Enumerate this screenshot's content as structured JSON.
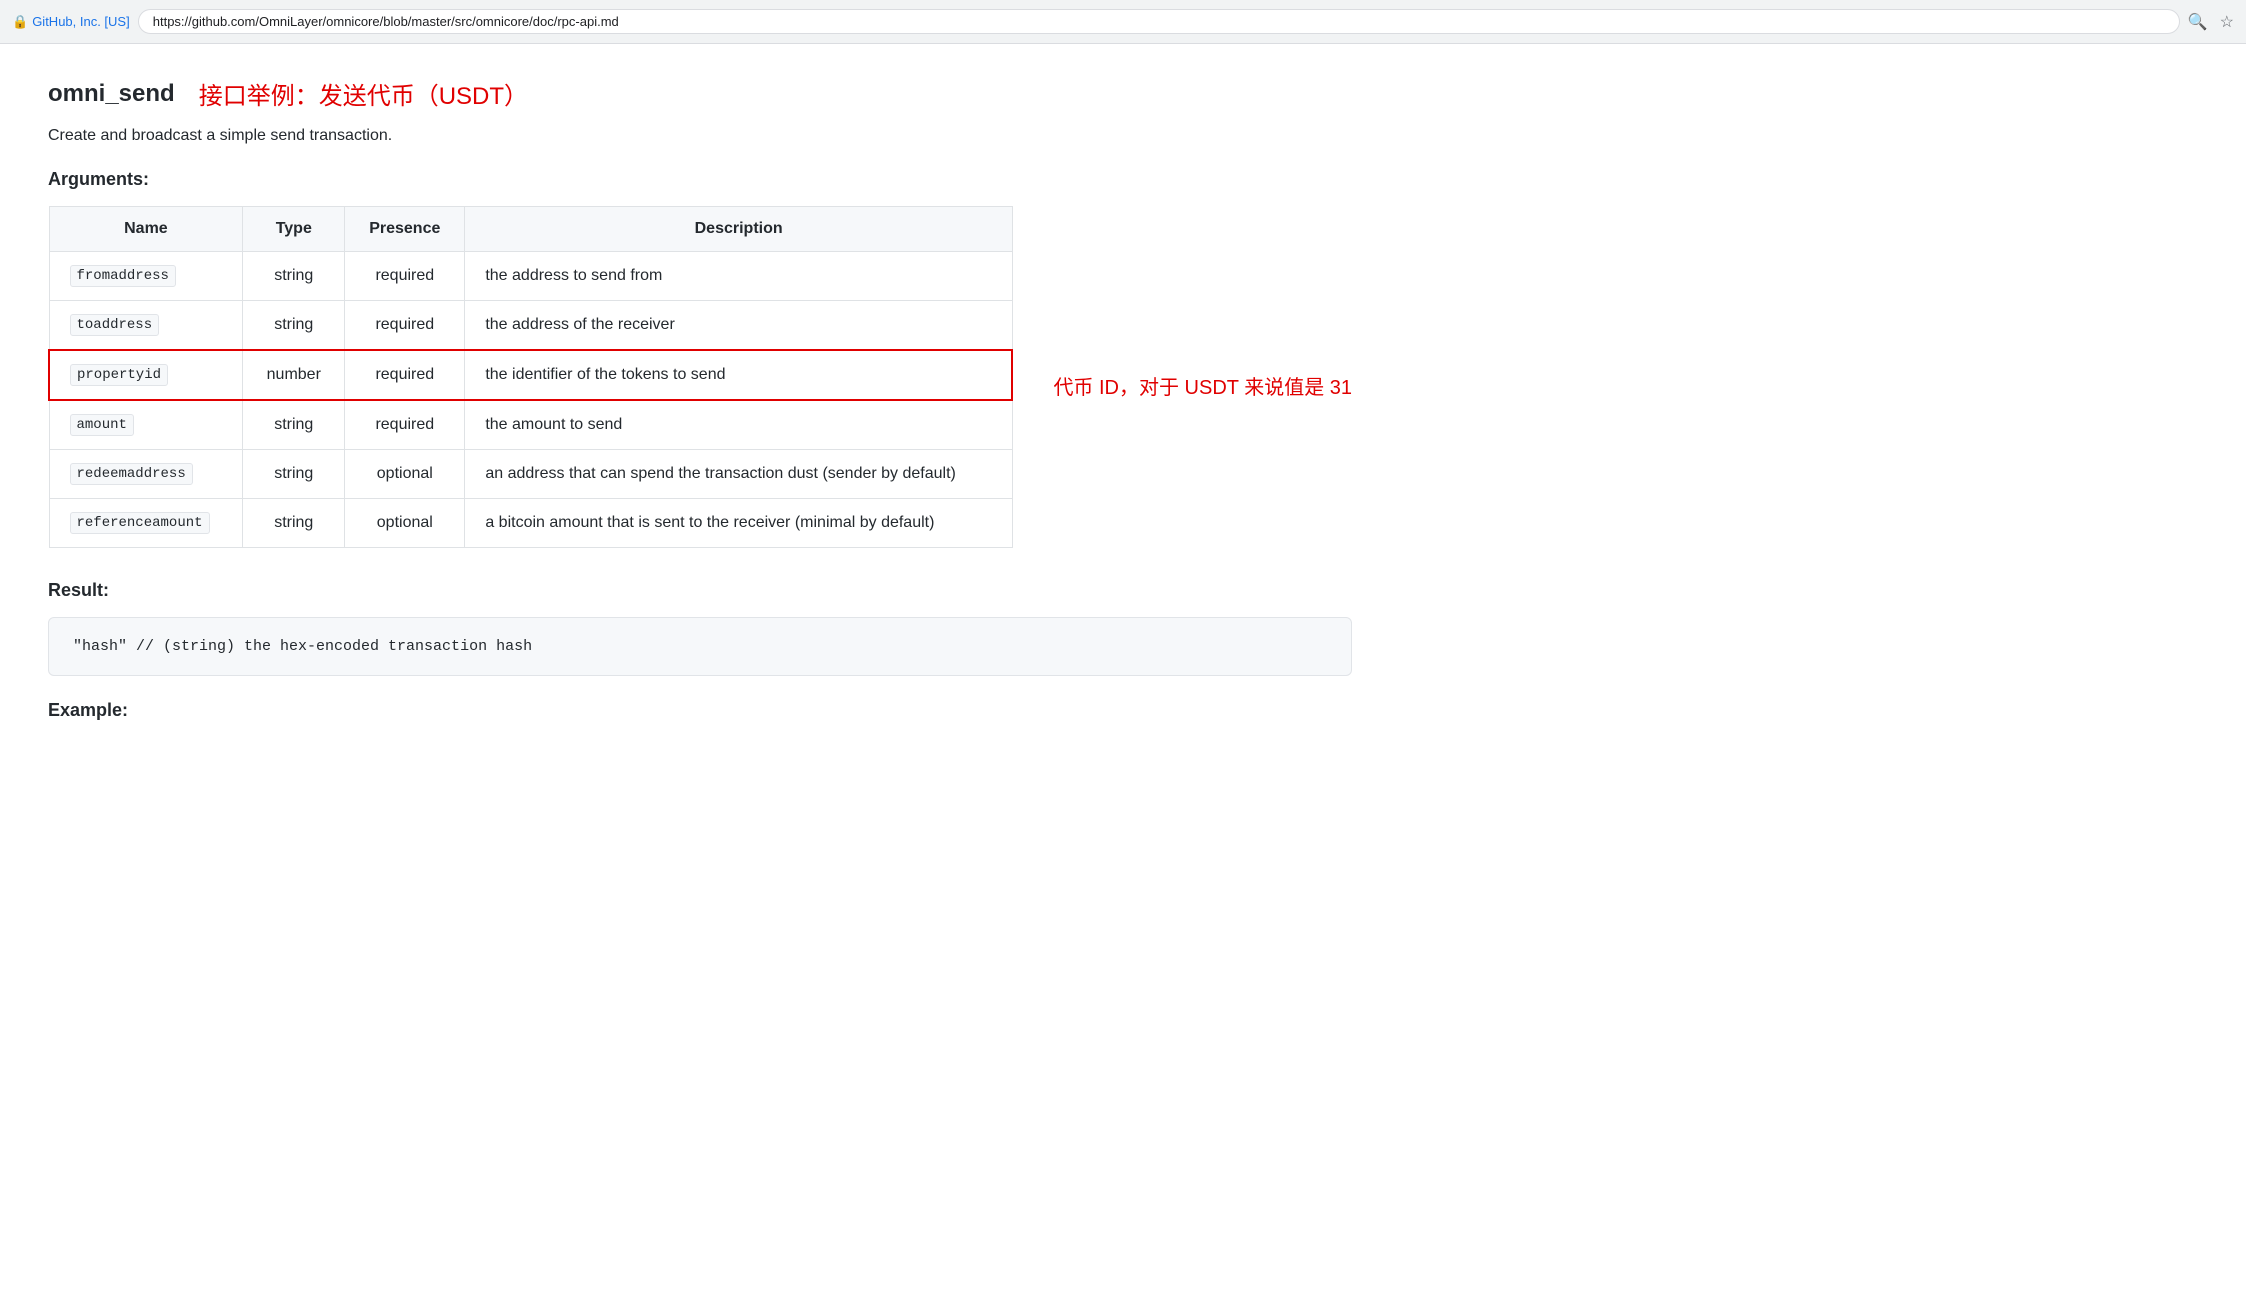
{
  "browser": {
    "security_label": "GitHub, Inc. [US]",
    "url": "https://github.com/OmniLayer/omnicore/blob/master/src/omnicore/doc/rpc-api.md",
    "url_prefix": "https://",
    "url_domain": "github.com",
    "url_path": "/OmniLayer/omnicore/blob/master/src/omnicore/doc/rpc-api.md"
  },
  "page": {
    "title": "omni_send",
    "chinese_subtitle": "接口举例：发送代币（USDT）",
    "description": "Create and broadcast a simple send transaction.",
    "arguments_heading": "Arguments:",
    "result_heading": "Result:",
    "example_heading": "Example:",
    "table": {
      "headers": [
        "Name",
        "Type",
        "Presence",
        "Description"
      ],
      "rows": [
        {
          "name": "fromaddress",
          "type": "string",
          "presence": "required",
          "description": "the address to send from",
          "highlighted": false
        },
        {
          "name": "toaddress",
          "type": "string",
          "presence": "required",
          "description": "the address of the receiver",
          "highlighted": false
        },
        {
          "name": "propertyid",
          "type": "number",
          "presence": "required",
          "description": "the identifier of the tokens to send",
          "highlighted": true,
          "annotation": "代币 ID，对于 USDT 来说值是 31"
        },
        {
          "name": "amount",
          "type": "string",
          "presence": "required",
          "description": "the amount to send",
          "highlighted": false
        },
        {
          "name": "redeemaddress",
          "type": "string",
          "presence": "optional",
          "description": "an address that can spend the transaction dust (sender by default)",
          "highlighted": false
        },
        {
          "name": "referenceamount",
          "type": "string",
          "presence": "optional",
          "description": "a bitcoin amount that is sent to the receiver (minimal by default)",
          "highlighted": false
        }
      ]
    },
    "code_result": "\"hash\"  // (string) the hex-encoded transaction hash"
  }
}
